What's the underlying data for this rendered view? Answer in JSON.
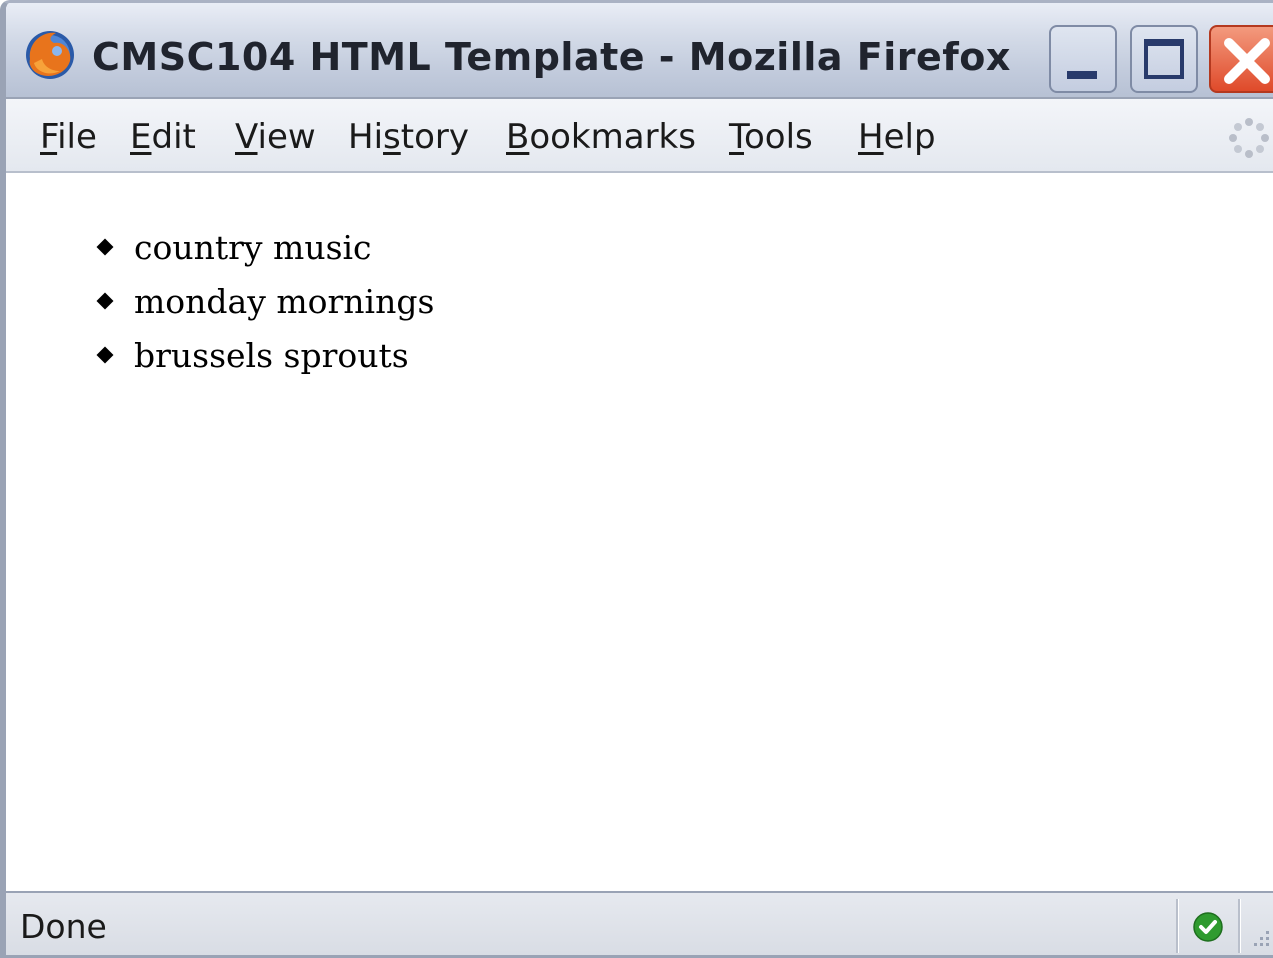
{
  "window": {
    "title": "CMSC104 HTML Template - Mozilla Firefox",
    "app_icon": "firefox-icon",
    "minimize_icon": "minimize-icon",
    "maximize_icon": "maximize-icon",
    "close_icon": "close-icon",
    "close_color": "#e0502f"
  },
  "menubar": {
    "items": [
      {
        "label": "File",
        "access_key": "F"
      },
      {
        "label": "Edit",
        "access_key": "E"
      },
      {
        "label": "View",
        "access_key": "V"
      },
      {
        "label": "History",
        "access_key": "s"
      },
      {
        "label": "Bookmarks",
        "access_key": "B"
      },
      {
        "label": "Tools",
        "access_key": "T"
      },
      {
        "label": "Help",
        "access_key": "H"
      }
    ],
    "throbber_icon": "throbber-icon"
  },
  "content": {
    "list_items": [
      "country music",
      "monday mornings",
      "brussels sprouts"
    ]
  },
  "statusbar": {
    "text": "Done",
    "security_icon": "green-check-icon",
    "security_color": "#2f9b2f"
  }
}
